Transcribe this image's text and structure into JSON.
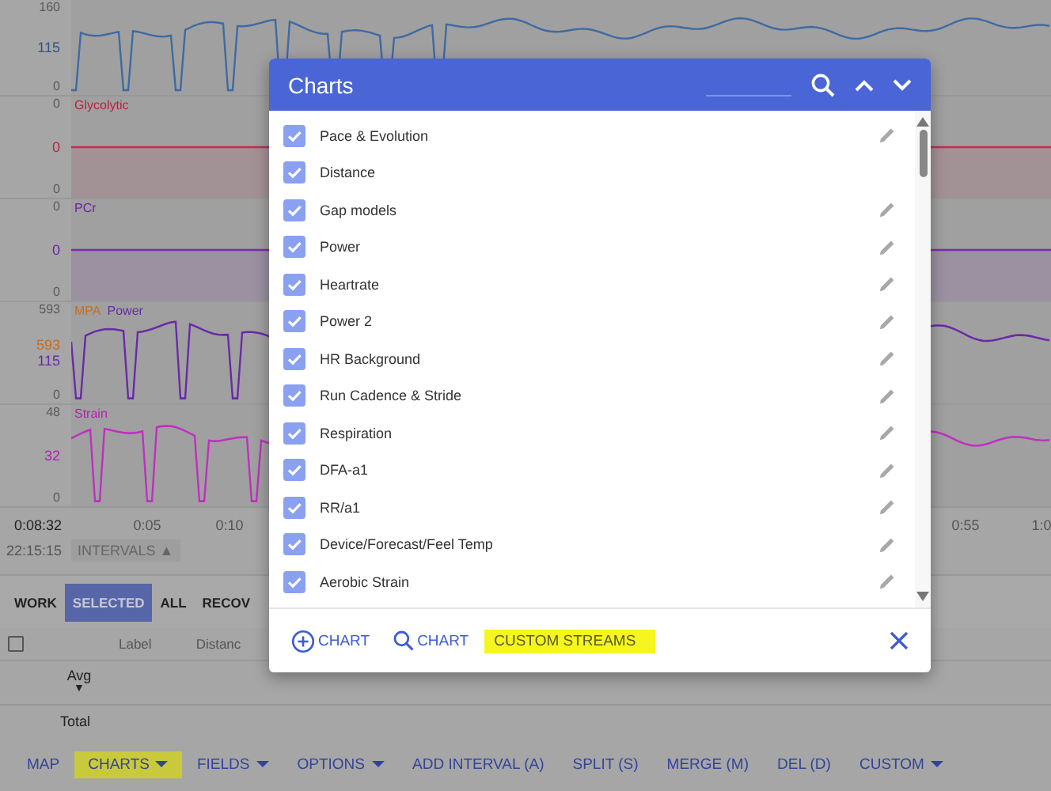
{
  "chart_panels": [
    {
      "kind": "trace",
      "color": "#3f6aa3",
      "axis": [
        {
          "text": "160"
        },
        {
          "text": "115",
          "color": "#34508a"
        },
        {
          "text": "0"
        }
      ]
    },
    {
      "kind": "flat",
      "color": "#c0304e",
      "series": [
        {
          "name": "Glycolytic",
          "color": "#b8243f"
        }
      ],
      "axis": [
        {
          "text": "0"
        },
        {
          "text": "0",
          "color": "#b8243f"
        },
        {
          "text": "0"
        }
      ]
    },
    {
      "kind": "flat",
      "color": "#7a2bb0",
      "series": [
        {
          "name": "PCr",
          "color": "#6e22a6"
        }
      ],
      "axis": [
        {
          "text": "0"
        },
        {
          "text": "0",
          "color": "#6e22a6"
        },
        {
          "text": "0"
        }
      ]
    },
    {
      "kind": "trace",
      "color": "#6a2aa8",
      "series": [
        {
          "name": "MPA",
          "color": "#c76f1e"
        },
        {
          "name": "Power",
          "color": "#6a2aa8"
        }
      ],
      "axis": [
        {
          "text": "593"
        },
        {
          "text": "593",
          "color": "#c76f1e"
        },
        {
          "text": "115",
          "color": "#6a2aa8"
        },
        {
          "text": "0"
        }
      ]
    },
    {
      "kind": "trace",
      "color": "#c030c0",
      "series": [
        {
          "name": "Strain",
          "color": "#b020b0"
        }
      ],
      "axis": [
        {
          "text": "48"
        },
        {
          "text": "32",
          "color": "#b020b0"
        },
        {
          "text": "0"
        }
      ]
    }
  ],
  "time_axis": {
    "elapsed": "0:08:32",
    "clock": "22:15:15",
    "intervals_button": "INTERVALS ▲",
    "ticks": [
      "0:05",
      "0:10",
      "0:55",
      "1:0"
    ]
  },
  "interval_tabs": [
    {
      "label": "WORK",
      "selected": false
    },
    {
      "label": "SELECTED",
      "selected": true
    },
    {
      "label": "ALL",
      "selected": false
    },
    {
      "label": "RECOV",
      "selected": false
    }
  ],
  "table": {
    "checked": false,
    "columns": [
      "Label",
      "Distanc"
    ],
    "avg_label": "Avg",
    "avg_caret": "▼",
    "total_label": "Total"
  },
  "toolbar": [
    {
      "label": "MAP",
      "dropdown": false,
      "highlighted": false
    },
    {
      "label": "CHARTS",
      "dropdown": true,
      "highlighted": true
    },
    {
      "label": "FIELDS",
      "dropdown": true,
      "highlighted": false
    },
    {
      "label": "OPTIONS",
      "dropdown": true,
      "highlighted": false
    },
    {
      "label": "ADD INTERVAL (A)",
      "dropdown": false,
      "highlighted": false
    },
    {
      "label": "SPLIT (S)",
      "dropdown": false,
      "highlighted": false
    },
    {
      "label": "MERGE (M)",
      "dropdown": false,
      "highlighted": false
    },
    {
      "label": "DEL (D)",
      "dropdown": false,
      "highlighted": false
    },
    {
      "label": "CUSTOM",
      "dropdown": true,
      "highlighted": false
    }
  ],
  "dialog": {
    "title": "Charts",
    "items": [
      {
        "label": "Pace & Evolution",
        "checked": true,
        "editable": true
      },
      {
        "label": "Distance",
        "checked": true,
        "editable": false
      },
      {
        "label": "Gap models",
        "checked": true,
        "editable": true
      },
      {
        "label": "Power",
        "checked": true,
        "editable": true
      },
      {
        "label": "Heartrate",
        "checked": true,
        "editable": true
      },
      {
        "label": "Power 2",
        "checked": true,
        "editable": true
      },
      {
        "label": "HR Background",
        "checked": true,
        "editable": true
      },
      {
        "label": "Run Cadence & Stride",
        "checked": true,
        "editable": true
      },
      {
        "label": "Respiration",
        "checked": true,
        "editable": true
      },
      {
        "label": "DFA-a1",
        "checked": true,
        "editable": true
      },
      {
        "label": "RR/a1",
        "checked": true,
        "editable": true
      },
      {
        "label": "Device/Forecast/Feel Temp",
        "checked": true,
        "editable": true
      },
      {
        "label": "Aerobic Strain",
        "checked": true,
        "editable": true
      }
    ],
    "footer": [
      {
        "kind": "add",
        "label": "CHART",
        "highlighted": false
      },
      {
        "kind": "search",
        "label": "CHART",
        "highlighted": false
      },
      {
        "kind": "plain",
        "label": "CUSTOM STREAMS",
        "highlighted": true
      }
    ]
  }
}
